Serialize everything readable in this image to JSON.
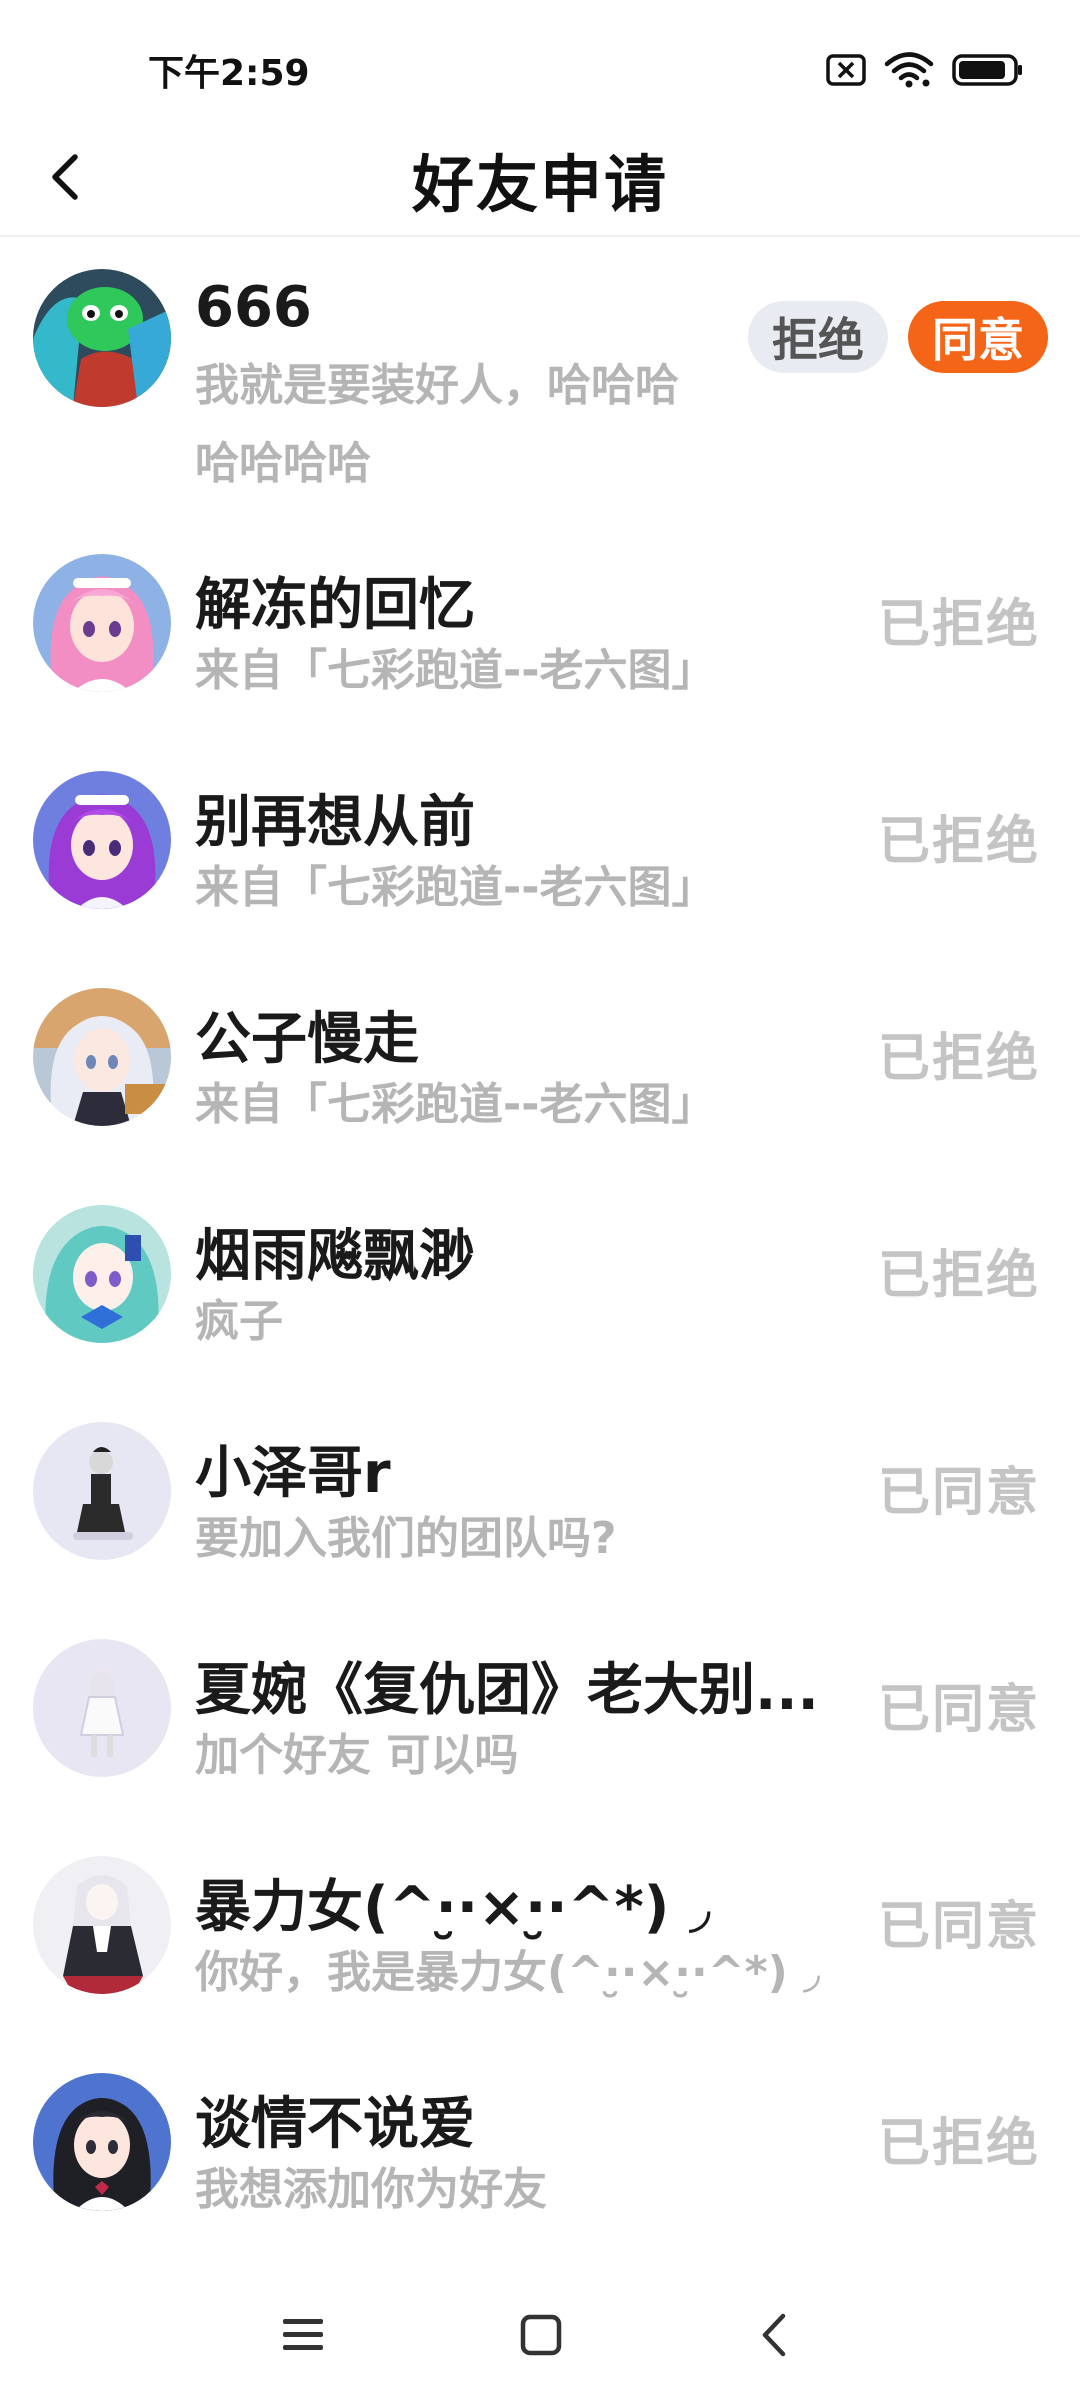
{
  "status_bar": {
    "time": "下午2:59",
    "icons": [
      "sim-off-icon",
      "wifi-icon",
      "battery-icon"
    ]
  },
  "header": {
    "title": "好友申请",
    "back_icon": "chevron-left-icon"
  },
  "requests": [
    {
      "name": "666",
      "message": "我就是要装好人，哈哈哈哈哈哈哈",
      "reject_label": "拒绝",
      "accept_label": "同意",
      "status": ""
    },
    {
      "name": "解冻的回忆",
      "message": "来自「七彩跑道--老六图」",
      "status": "已拒绝"
    },
    {
      "name": "别再想从前",
      "message": "来自「七彩跑道--老六图」",
      "status": "已拒绝"
    },
    {
      "name": "公子慢走",
      "message": "来自「七彩跑道--老六图」",
      "status": "已拒绝"
    },
    {
      "name": "烟雨飚飘渺",
      "message": "疯子",
      "status": "已拒绝"
    },
    {
      "name": "小泽哥r",
      "message": "要加入我们的团队吗?",
      "status": "已同意"
    },
    {
      "name": "夏婉《复仇团》老大别...",
      "message": "加个好友 可以吗",
      "status": "已同意"
    },
    {
      "name": "暴力女(^·̮·×·̮·^*) ◞",
      "message": "你好，我是暴力女(^·̮·×·̮·^*) ◞",
      "status": "已同意"
    },
    {
      "name": "谈情不说爱",
      "message": "我想添加你为好友",
      "status": "已拒绝"
    }
  ],
  "colors": {
    "accent": "#f56518",
    "reject_bg": "#e9ebf2",
    "muted_text": "#b5b5b5",
    "status_text": "#c4c4c4"
  },
  "nav_bar": {
    "icons": [
      "menu-icon",
      "home-icon",
      "back-icon"
    ]
  }
}
